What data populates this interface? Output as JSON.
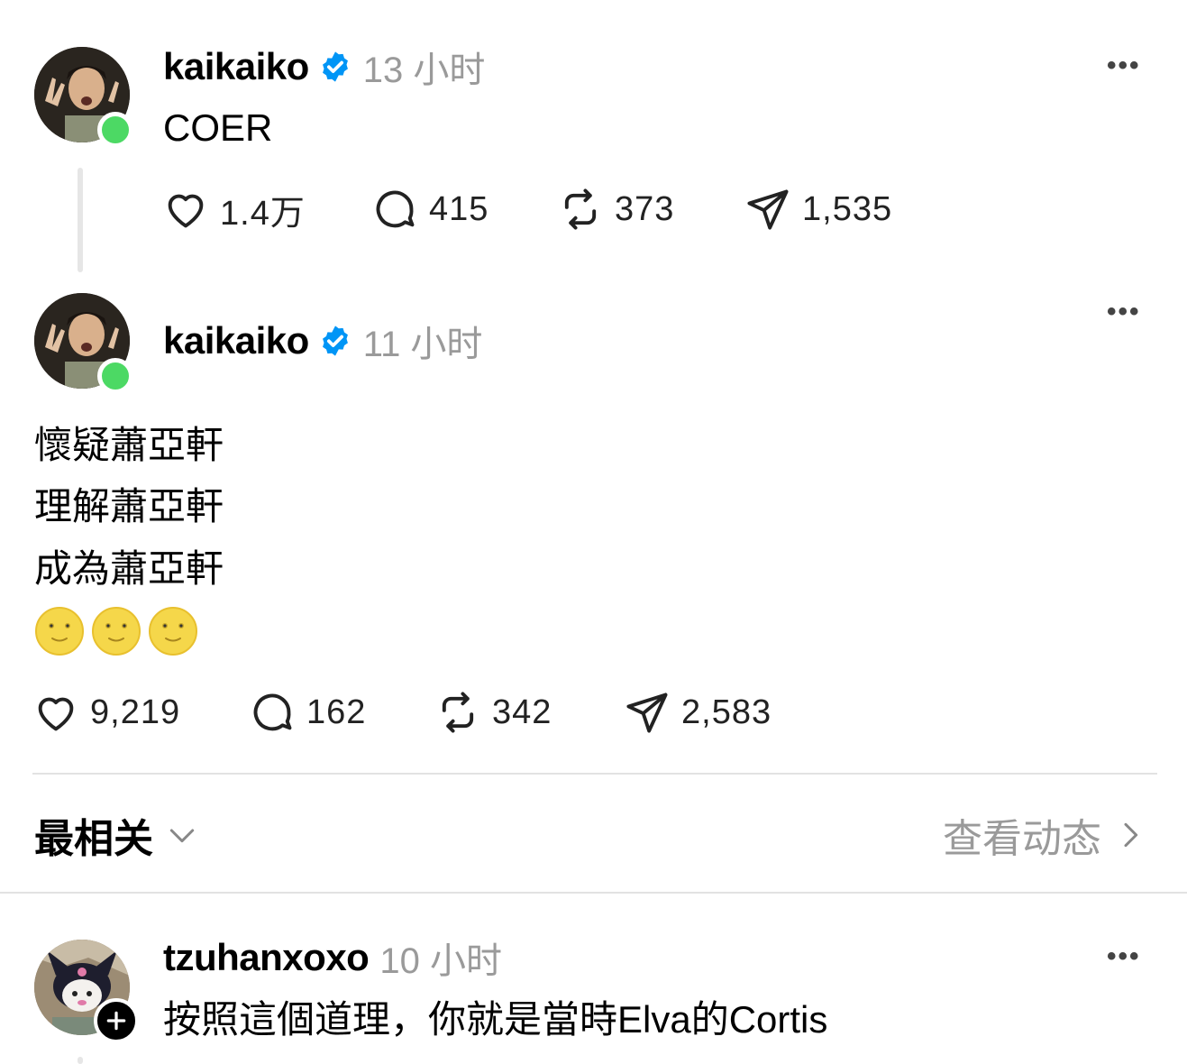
{
  "posts": [
    {
      "username": "kaikaiko",
      "time": "13 小时",
      "text": "COER",
      "actions": {
        "likes": "1.4万",
        "comments": "415",
        "reposts": "373",
        "shares": "1,535"
      }
    },
    {
      "username": "kaikaiko",
      "time": "11 小时",
      "lines": [
        "懷疑蕭亞軒",
        "理解蕭亞軒",
        "成為蕭亞軒"
      ],
      "emoji_count": 3,
      "actions": {
        "likes": "9,219",
        "comments": "162",
        "reposts": "342",
        "shares": "2,583"
      }
    }
  ],
  "replies_bar": {
    "sort_label": "最相关",
    "view_activity": "查看动态"
  },
  "reply": {
    "username": "tzuhanxoxo",
    "time": "10 小时",
    "text": "按照這個道理，你就是當時Elva的Cortis"
  },
  "colors": {
    "online": "#4cd964",
    "verified": "#0095f6",
    "muted": "#9a9a9a"
  },
  "icons": [
    "heart-icon",
    "comment-icon",
    "repost-icon",
    "share-icon",
    "verified-badge-icon",
    "more-icon",
    "chevron-down-icon",
    "chevron-right-icon",
    "plus-icon"
  ]
}
